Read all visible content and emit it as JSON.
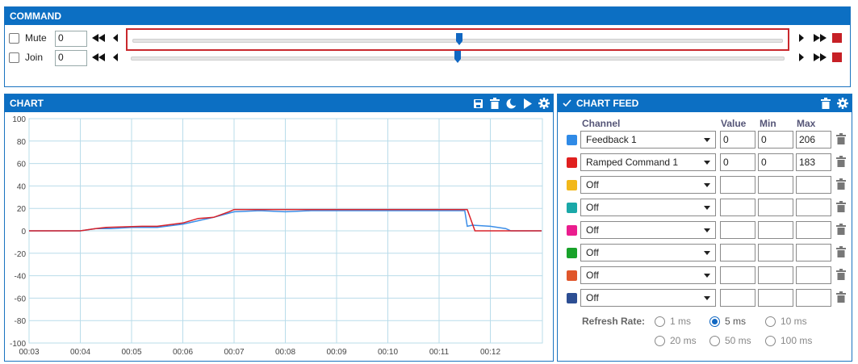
{
  "command": {
    "title": "COMMAND",
    "rows": [
      {
        "label": "Mute",
        "value": "0",
        "slider_fraction": 0.5
      },
      {
        "label": "Join",
        "value": "0",
        "slider_fraction": 0.5
      }
    ]
  },
  "chart_panel": {
    "title": "CHART",
    "icons": [
      "save-icon",
      "trash-icon",
      "moon-icon",
      "play-icon",
      "gear-icon"
    ]
  },
  "chart_data": {
    "type": "line",
    "xlim": [
      0,
      10
    ],
    "ylim": [
      -100,
      100
    ],
    "yticks": [
      100,
      80,
      60,
      40,
      20,
      0,
      -20,
      -40,
      -60,
      -80,
      -100
    ],
    "xticks": [
      "00:03",
      "00:04",
      "00:05",
      "00:06",
      "00:07",
      "00:08",
      "00:09",
      "00:10",
      "00:11",
      "00:12"
    ],
    "grid": true,
    "series": [
      {
        "color": "#3b8ee8",
        "x": [
          0,
          1,
          1.3,
          1.6,
          2.0,
          2.5,
          3.0,
          3.3,
          3.6,
          4.0,
          4.5,
          5.0,
          5.5,
          6.0,
          6.5,
          7.0,
          7.5,
          8.0,
          8.5,
          8.55,
          8.65,
          9.0,
          9.3,
          9.4,
          10
        ],
        "y": [
          0,
          0,
          2,
          2,
          3,
          3,
          6,
          9,
          12,
          17,
          18,
          17,
          18,
          18,
          18,
          18,
          18,
          18,
          18,
          4,
          5,
          4,
          2,
          0,
          0
        ]
      },
      {
        "color": "#d9222a",
        "x": [
          0,
          1,
          1.3,
          1.5,
          2.2,
          2.5,
          3.0,
          3.3,
          3.6,
          3.9,
          4.0,
          4.5,
          5.0,
          6.0,
          7.0,
          8.0,
          8.55,
          8.7,
          9.3,
          10
        ],
        "y": [
          0,
          0,
          2,
          3,
          4,
          4,
          7,
          11,
          12,
          17,
          19,
          19,
          19,
          19,
          19,
          19,
          19,
          0,
          0,
          0
        ]
      }
    ]
  },
  "feed": {
    "title": "CHART FEED",
    "headers": {
      "channel": "Channel",
      "value": "Value",
      "min": "Min",
      "max": "Max"
    },
    "rows": [
      {
        "color": "#2f8ae6",
        "channel": "Feedback 1",
        "value": "0",
        "min": "0",
        "max": "206"
      },
      {
        "color": "#e0201f",
        "channel": "Ramped Command 1",
        "value": "0",
        "min": "0",
        "max": "183"
      },
      {
        "color": "#f2b81a",
        "channel": "Off",
        "value": "",
        "min": "",
        "max": ""
      },
      {
        "color": "#1aa8a8",
        "channel": "Off",
        "value": "",
        "min": "",
        "max": ""
      },
      {
        "color": "#ea1d8e",
        "channel": "Off",
        "value": "",
        "min": "",
        "max": ""
      },
      {
        "color": "#18a22a",
        "channel": "Off",
        "value": "",
        "min": "",
        "max": ""
      },
      {
        "color": "#e0562b",
        "channel": "Off",
        "value": "",
        "min": "",
        "max": ""
      },
      {
        "color": "#2c4e93",
        "channel": "Off",
        "value": "",
        "min": "",
        "max": ""
      }
    ],
    "refresh_label": "Refresh Rate:",
    "refresh_options": [
      "1 ms",
      "5 ms",
      "10 ms",
      "20 ms",
      "50 ms",
      "100 ms"
    ],
    "refresh_selected": "5 ms"
  },
  "colors": {
    "panel_header": "#0c6fc3",
    "grid": "#b9dcea",
    "focus_outline": "#c9282d"
  }
}
